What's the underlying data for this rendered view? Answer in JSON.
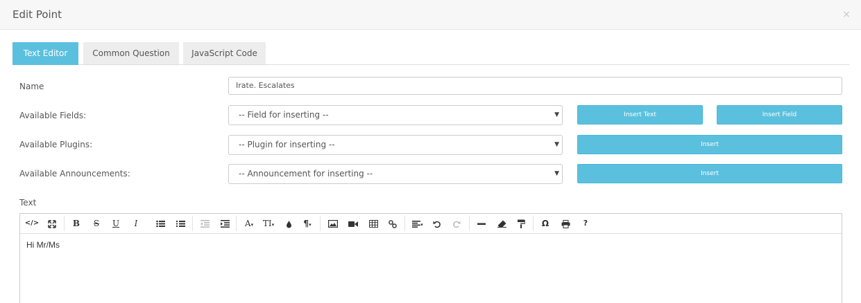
{
  "modal": {
    "title": "Edit Point",
    "close": "×"
  },
  "tabs": [
    {
      "label": "Text Editor",
      "active": true
    },
    {
      "label": "Common Question",
      "active": false
    },
    {
      "label": "JavaScript Code",
      "active": false
    }
  ],
  "form": {
    "name_label": "Name",
    "name_value": "Irate. Escalates",
    "fields_label": "Available Fields:",
    "fields_select": "-- Field for inserting --",
    "insert_text_button": "Insert Text",
    "insert_field_button": "Insert Field",
    "plugins_label": "Available Plugins:",
    "plugins_select": "-- Plugin for inserting --",
    "plugins_insert_button": "Insert",
    "announcements_label": "Available Announcements:",
    "announcements_select": "-- Announcement for inserting --",
    "announcements_insert_button": "Insert",
    "text_label": "Text"
  },
  "editor": {
    "content": "Hi Mr/Ms",
    "toolbar": {
      "code_view": "</>",
      "bold": "B",
      "strikethrough": "S",
      "underline": "U",
      "italic": "I",
      "font_family": "A",
      "font_size": "TI",
      "paragraph": "¶",
      "special_char": "Ω",
      "help": "?"
    }
  },
  "colors": {
    "accent": "#5bc0de",
    "header_bg": "#f7f7f7"
  }
}
